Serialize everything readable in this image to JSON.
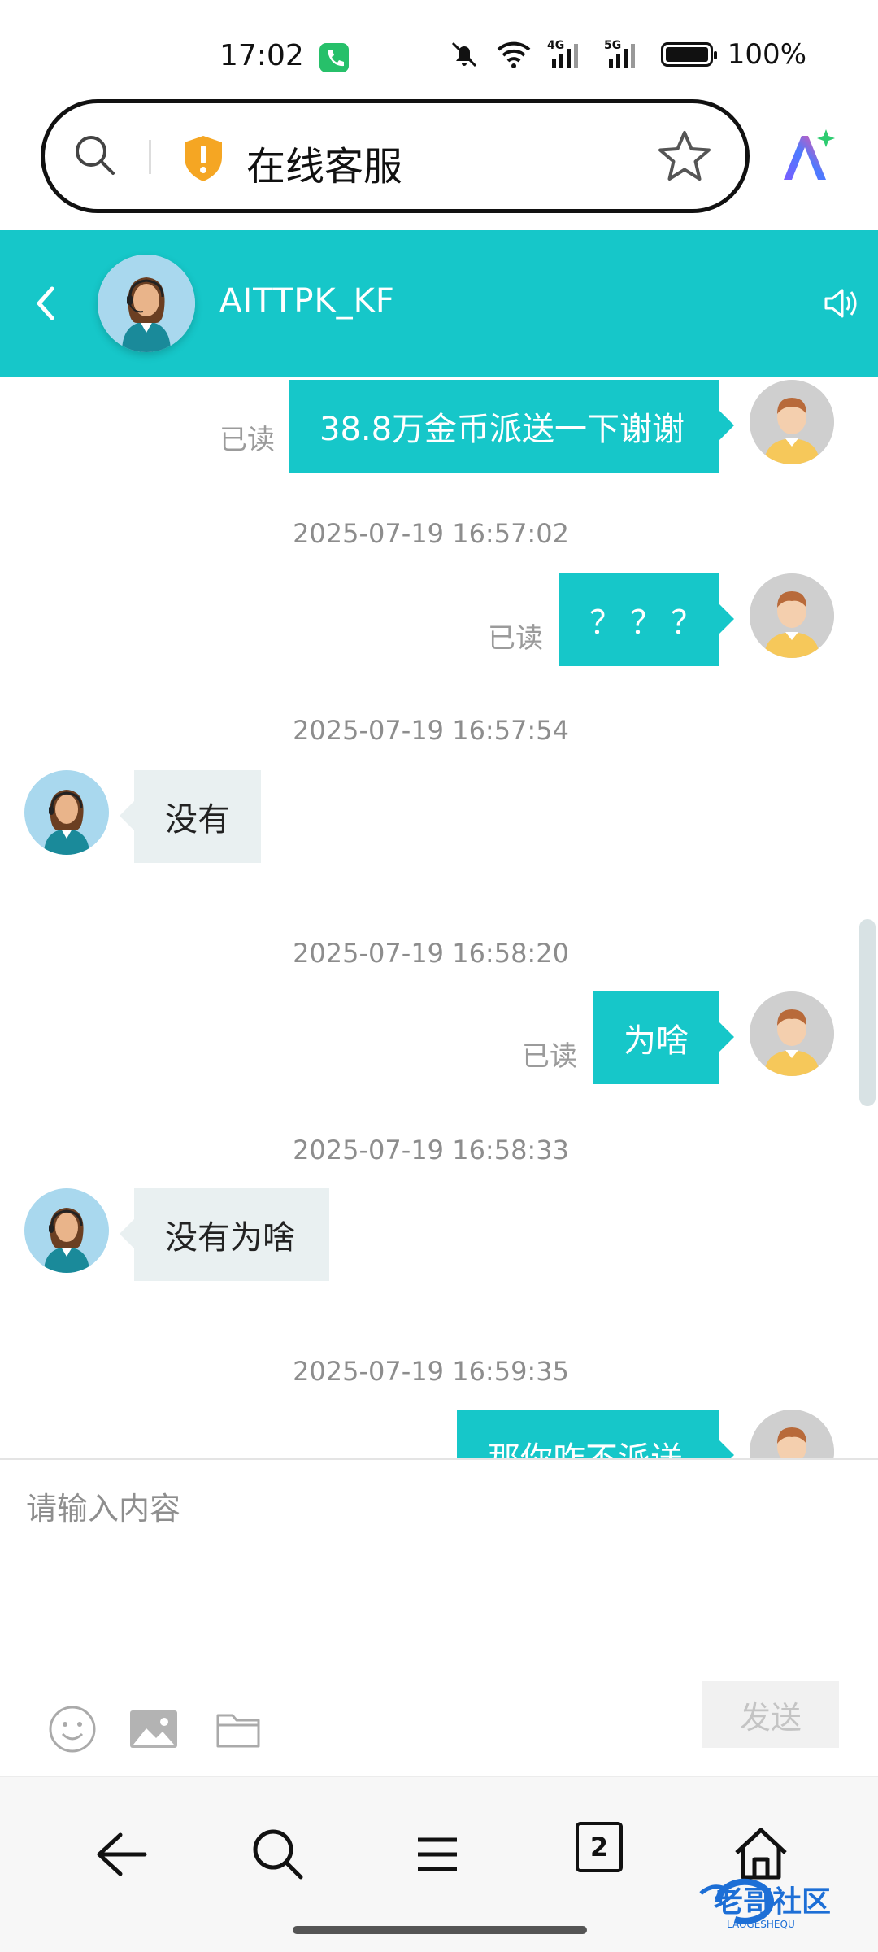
{
  "status_bar": {
    "time": "17:02",
    "battery": "100%",
    "network_1": "4G",
    "network_2": "5G"
  },
  "browser": {
    "title": "在线客服"
  },
  "chat_header": {
    "name": "AITTPK_KF"
  },
  "messages": {
    "m1": {
      "text": "38.8万金币派送一下谢谢",
      "read": "已读"
    },
    "t2": "2025-07-19 16:57:02",
    "m2": {
      "text": "？？？",
      "read": "已读"
    },
    "t3": "2025-07-19 16:57:54",
    "m3": {
      "text": "没有"
    },
    "t4": "2025-07-19 16:58:20",
    "m4": {
      "text": "为啥",
      "read": "已读"
    },
    "t5": "2025-07-19 16:58:33",
    "m5": {
      "text": "没有为啥"
    },
    "t6": "2025-07-19 16:59:35",
    "m6": {
      "text": "那你咋不派送"
    }
  },
  "input": {
    "placeholder": "请输入内容",
    "send_label": "发送"
  },
  "bottom_nav": {
    "tab_count": "2"
  },
  "watermark": {
    "text": "老哥社区",
    "sub": "LAOGESHEQU"
  },
  "colors": {
    "accent": "#16c7c9",
    "incoming_bubble": "#e9f0f1",
    "user_shirt": "#f6c85a"
  }
}
